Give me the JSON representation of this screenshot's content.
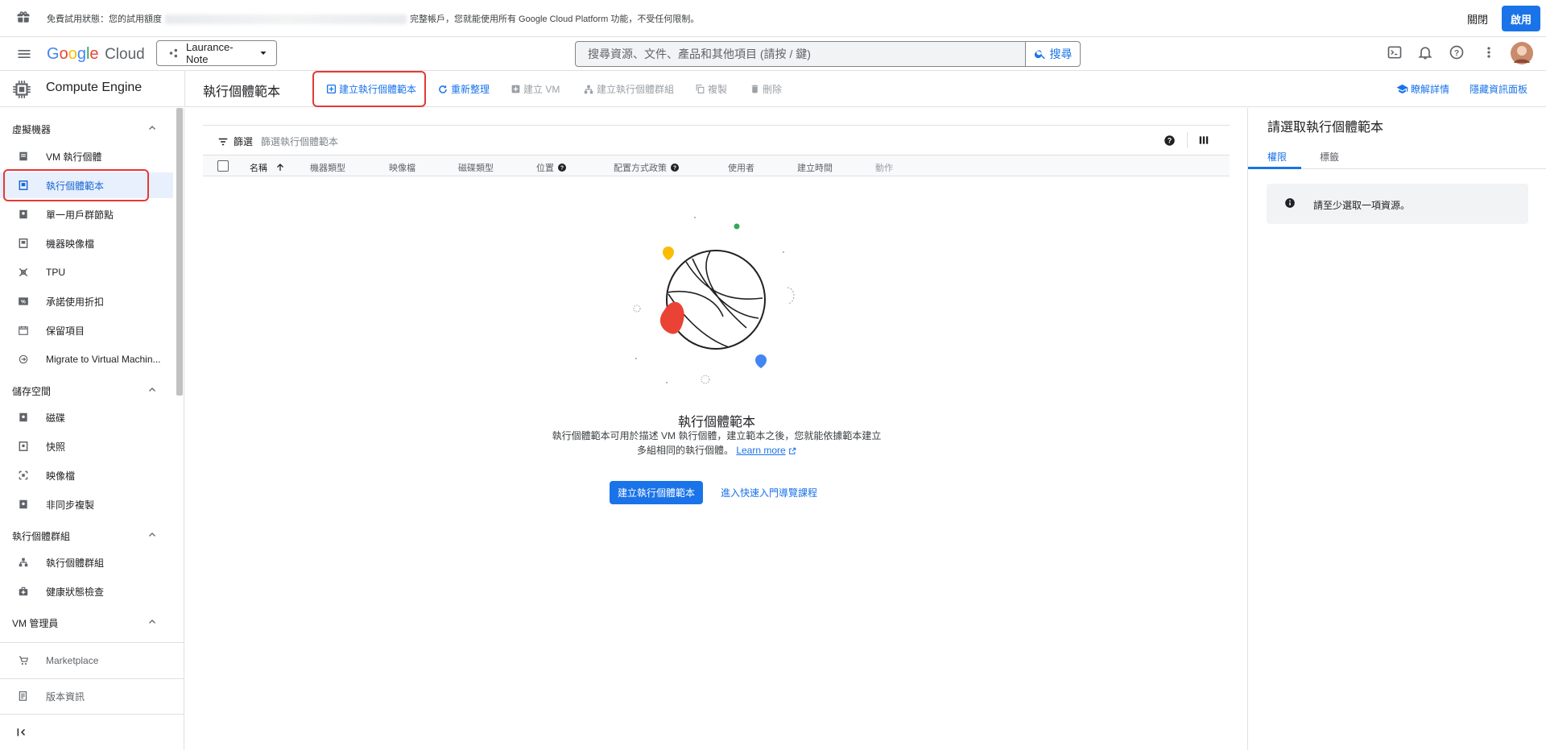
{
  "banner": {
    "text_start": "免費試用狀態：您的試用額度",
    "text_end": "完整帳戶，您就能使用所有 Google Cloud Platform 功能，不受任何限制。",
    "close_label": "關閉",
    "enable_label": "啟用"
  },
  "header": {
    "logo_g": "G",
    "logo_o1": "o",
    "logo_o2": "o",
    "logo_g2": "g",
    "logo_l": "l",
    "logo_e": "e",
    "logo_cloud": "Cloud",
    "project": "Laurance-Note",
    "search_placeholder": "搜尋資源、文件、產品和其他項目 (請按 / 鍵)",
    "search_button": "搜尋"
  },
  "product": {
    "name": "Compute Engine",
    "page_title": "執行個體範本",
    "toolbar": {
      "create_template": "建立執行個體範本",
      "refresh": "重新整理",
      "create_vm": "建立 VM",
      "create_group": "建立執行個體群組",
      "copy": "複製",
      "delete": "刪除",
      "learn": "瞭解詳情",
      "hide_panel": "隱藏資訊面板"
    }
  },
  "sidebar": {
    "sections": [
      {
        "title": "虛擬機器",
        "items": [
          "VM 執行個體",
          "執行個體範本",
          "單一用戶群節點",
          "機器映像檔",
          "TPU",
          "承諾使用折扣",
          "保留項目",
          "Migrate to Virtual Machin..."
        ]
      },
      {
        "title": "儲存空間",
        "items": [
          "磁碟",
          "快照",
          "映像檔",
          "非同步複製"
        ]
      },
      {
        "title": "執行個體群組",
        "items": [
          "執行個體群組",
          "健康狀態檢查"
        ]
      },
      {
        "title": "VM 管理員",
        "items": []
      }
    ],
    "marketplace": "Marketplace",
    "release_notes": "版本資訊"
  },
  "table": {
    "filter_label": "篩選",
    "filter_placeholder": "篩選執行個體範本",
    "columns": [
      "名稱",
      "機器類型",
      "映像檔",
      "磁碟類型",
      "位置",
      "配置方式政策",
      "使用者",
      "建立時間",
      "動作"
    ]
  },
  "empty": {
    "title": "執行個體範本",
    "desc": "執行個體範本可用於描述 VM 執行個體，建立範本之後，您就能依據範本建立多組相同的執行個體。",
    "learn_more": "Learn more",
    "cta": "建立執行個體範本",
    "quickstart": "進入快速入門導覽課程"
  },
  "right_panel": {
    "title": "請選取執行個體範本",
    "tabs": [
      "權限",
      "標籤"
    ],
    "info": "請至少選取一項資源。"
  },
  "colors": {
    "accent": "#1a73e8",
    "highlight": "#e53935"
  }
}
